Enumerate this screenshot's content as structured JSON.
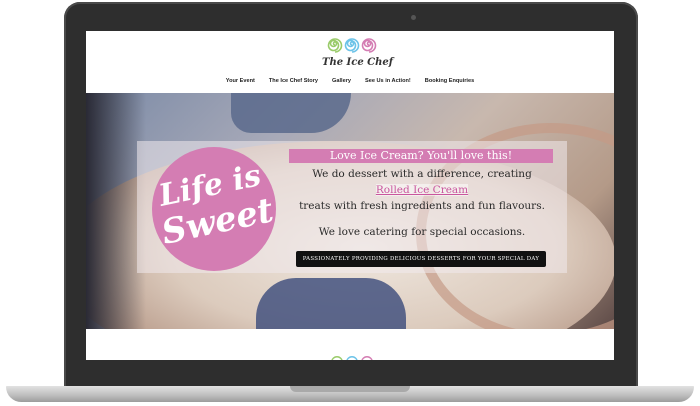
{
  "site": {
    "logo_text": "The Ice Chef",
    "logo_swirl_colors": [
      "#9acb6a",
      "#6cc3e8",
      "#d47db3"
    ]
  },
  "nav": {
    "items": [
      "Your Event",
      "The Ice Chef Story",
      "Gallery",
      "See Us in Action!",
      "Booking Enquiries"
    ]
  },
  "hero": {
    "badge_line1": "Life is",
    "badge_line2": "Sweet",
    "headline": "Love Ice Cream? You'll love this!",
    "line1": "We do dessert with a difference, creating",
    "link_text": "Rolled Ice Cream",
    "line3": "treats with fresh ingredients and fun flavours.",
    "line4": "We love catering for special occasions.",
    "cta": "PASSIONATELY PROVIDING DELICIOUS DESSERTS FOR YOUR SPECIAL DAY"
  },
  "colors": {
    "accent_pink": "#d47db3",
    "cta_bg": "#111111"
  }
}
